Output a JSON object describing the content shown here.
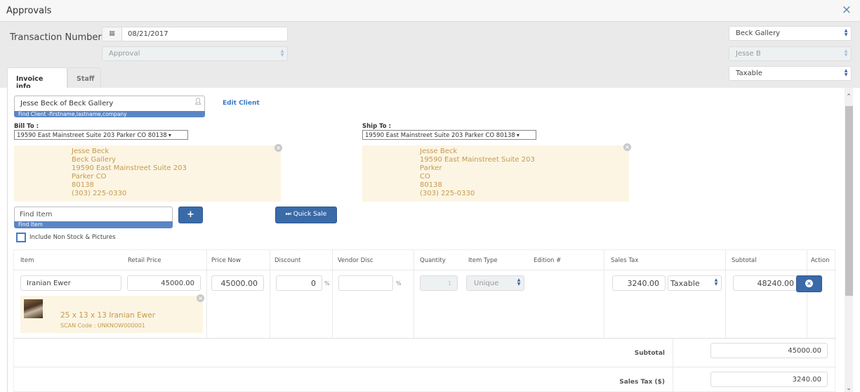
{
  "window": {
    "title": "Approvals",
    "close_icon": "×"
  },
  "header": {
    "transaction_label": "Transaction Number",
    "date_icon": "▦",
    "date_value": "08/21/2017",
    "type_select": "Approval",
    "location_select": "Beck Gallery",
    "staff_select": "Jesse B",
    "tax_select": "Taxable"
  },
  "tabs": [
    {
      "label": "Invoice info",
      "active": true
    },
    {
      "label": "Staff",
      "active": false
    }
  ],
  "client": {
    "value": "Jesse Beck of Beck Gallery",
    "hint": "Find Client -firstname,lastname,company",
    "edit_label": "Edit Client"
  },
  "bill_to": {
    "label": "Bill To :",
    "selected": "19590 East Mainstreet Suite 203 Parker CO 80138",
    "lines": [
      "Jesse Beck",
      "Beck Gallery",
      "19590 East Mainstreet Suite 203",
      "Parker CO",
      "80138",
      "(303) 225-0330"
    ]
  },
  "ship_to": {
    "label": "Ship To :",
    "selected": "19590 East Mainstreet Suite 203 Parker CO 80138",
    "lines": [
      "Jesse Beck",
      "19590 East Mainstreet Suite 203",
      "Parker",
      "CO",
      "80138",
      "(303) 225-0330"
    ]
  },
  "find_item": {
    "placeholder": "Find Item",
    "hint": "Find Item",
    "add_label": "+",
    "quick_sale_icon": "⏭",
    "quick_sale_label": "Quick Sale",
    "include_non_stock_label": "Include Non Stock & Pictures",
    "include_non_stock_checked": false
  },
  "table": {
    "columns": [
      "Item",
      "Retail Price",
      "Price Now",
      "Discount",
      "Vendor Disc",
      "Quantity",
      "Item Type",
      "Edition #",
      "Sales Tax",
      "Subtotal",
      "Action"
    ],
    "rows": [
      {
        "item": "Iranian Ewer",
        "retail_price": "45000.00",
        "price_now": "45000.00",
        "discount": "0",
        "discount_unit": "%",
        "vendor_disc": "",
        "vendor_disc_unit": "%",
        "quantity": "1",
        "item_type": "Unique",
        "edition": "",
        "sales_tax": "3240.00",
        "tax_status": "Taxable",
        "subtotal": "48240.00",
        "description": "25 x 13 x 13 Iranian Ewer",
        "scan_code": "SCAN Code : UNKNOW000001"
      }
    ]
  },
  "summary": {
    "subtotal_label": "Subtotal",
    "subtotal_value": "45000.00",
    "sales_tax_label": "Sales Tax ($)",
    "sales_tax_value": "3240.00"
  }
}
